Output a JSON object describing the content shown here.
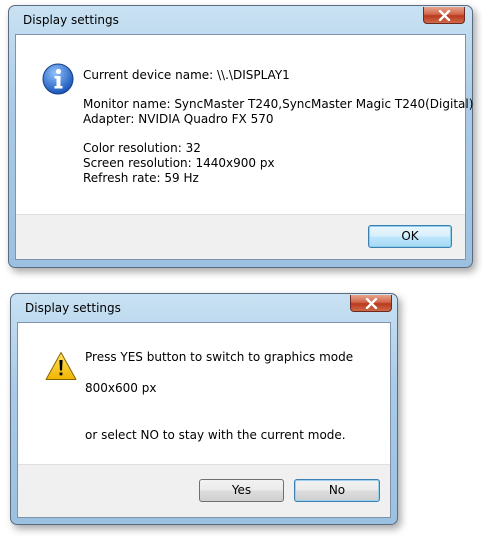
{
  "dialog_info": {
    "title": "Display settings",
    "device_line": "Current device name: \\\\.\\DISPLAY1",
    "monitor_line": "Monitor name: SyncMaster T240,SyncMaster Magic T240(Digital)",
    "adapter_line": "Adapter: NVIDIA Quadro FX 570",
    "color_line": "Color resolution: 32",
    "screen_line": "Screen resolution: 1440x900 px",
    "refresh_line": "Refresh rate: 59 Hz",
    "ok_label": "OK",
    "icon": "information-icon"
  },
  "dialog_confirm": {
    "title": "Display settings",
    "line1": "Press YES button to switch to graphics mode",
    "line2": "800x600 px",
    "line3": "or select NO to stay with the current mode.",
    "yes_label": "Yes",
    "no_label": "No",
    "icon": "warning-icon"
  },
  "colors": {
    "frame": "#a9cbe7",
    "close_button": "#c9492b",
    "footer": "#f0f0f0",
    "info_icon": "#1f66c7",
    "warning_icon": "#f2c200"
  }
}
